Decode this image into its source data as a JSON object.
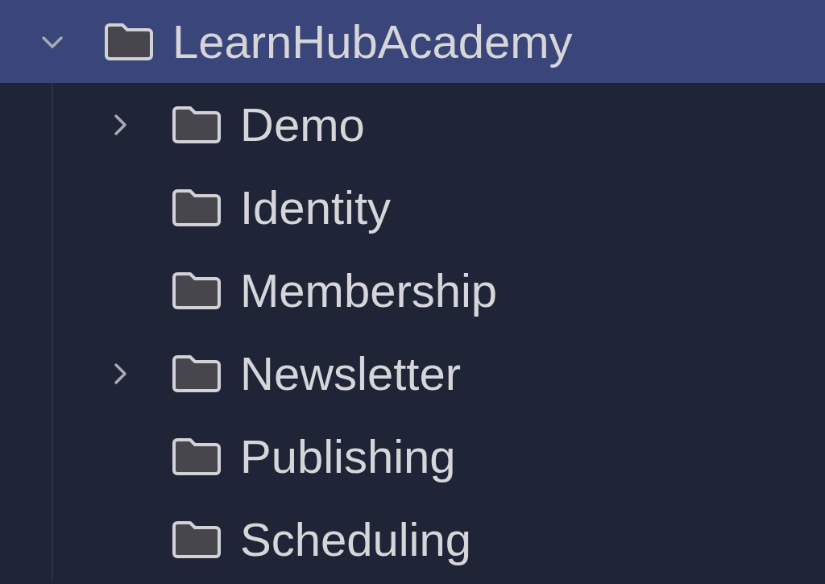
{
  "tree": {
    "label": "LearnHubAcademy",
    "expanded": true,
    "selected": true,
    "children": [
      {
        "label": "Demo",
        "expandable": true,
        "expanded": false,
        "selected": false
      },
      {
        "label": "Identity",
        "expandable": false,
        "expanded": false,
        "selected": false
      },
      {
        "label": "Membership",
        "expandable": false,
        "expanded": false,
        "selected": false
      },
      {
        "label": "Newsletter",
        "expandable": true,
        "expanded": false,
        "selected": false
      },
      {
        "label": "Publishing",
        "expandable": false,
        "expanded": false,
        "selected": false
      },
      {
        "label": "Scheduling",
        "expandable": false,
        "expanded": false,
        "selected": false
      }
    ]
  }
}
